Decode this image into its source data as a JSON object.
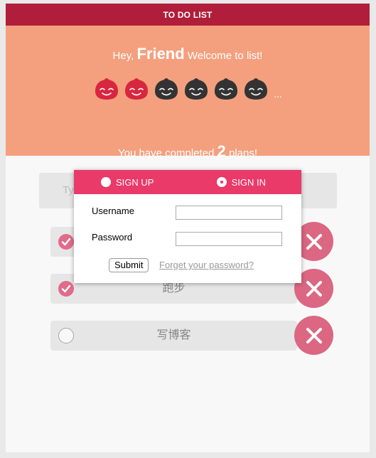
{
  "app": {
    "title": "TO DO LIST"
  },
  "hero": {
    "greet_prefix": "Hey,",
    "name": "Friend",
    "greet_suffix": "Welcome to list!",
    "faces": [
      {
        "color": "#d8263f"
      },
      {
        "color": "#d8263f"
      },
      {
        "color": "#333333"
      },
      {
        "color": "#333333"
      },
      {
        "color": "#333333"
      },
      {
        "color": "#333333"
      }
    ],
    "ellipsis": "...",
    "completed_prefix": "You have completed",
    "completed_count": "2",
    "completed_suffix": "plans!"
  },
  "input": {
    "placeholder": "Ty"
  },
  "tasks": [
    {
      "label": "",
      "done": true
    },
    {
      "label": "跑步",
      "done": true
    },
    {
      "label": "写博客",
      "done": false
    }
  ],
  "modal": {
    "tab_signup": "SIGN UP",
    "tab_signin": "SIGN IN",
    "username_label": "Username",
    "password_label": "Password",
    "username_value": "",
    "password_value": "",
    "submit_label": "Submit",
    "forgot_label": "Forget your password?"
  },
  "colors": {
    "accent": "#e93a6a",
    "header": "#b01e3b",
    "hero_bg": "#f4a07e",
    "delete": "#c8163f"
  }
}
